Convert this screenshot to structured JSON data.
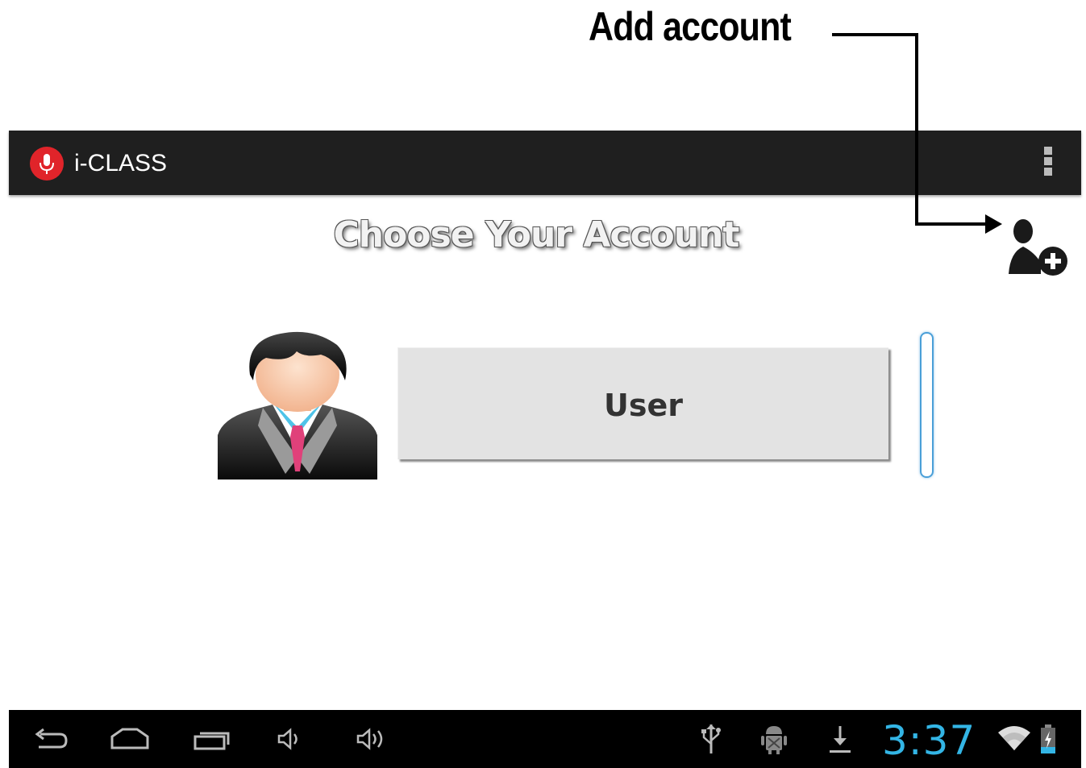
{
  "annotation": {
    "label": "Add account"
  },
  "action_bar": {
    "app_title": "i-CLASS",
    "app_icon": "microphone-icon",
    "overflow_icon": "overflow-menu-icon"
  },
  "main": {
    "screen_title": "Choose Your Account",
    "add_account_icon": "add-account-icon",
    "accounts": [
      {
        "name": "User",
        "avatar": "businessman-avatar"
      }
    ]
  },
  "system_bar": {
    "nav": [
      "back-icon",
      "home-icon",
      "recent-apps-icon",
      "volume-down-icon",
      "volume-up-icon"
    ],
    "status_icons": [
      "usb-icon",
      "android-debug-icon",
      "download-icon",
      "wifi-icon",
      "battery-charging-icon"
    ],
    "clock": "3:37"
  },
  "colors": {
    "action_bar": "#1f1f1f",
    "system_bar": "#000000",
    "accent_blue": "#33b5e5",
    "app_icon_red": "#e0242a",
    "button_gray": "#e3e3e3"
  }
}
